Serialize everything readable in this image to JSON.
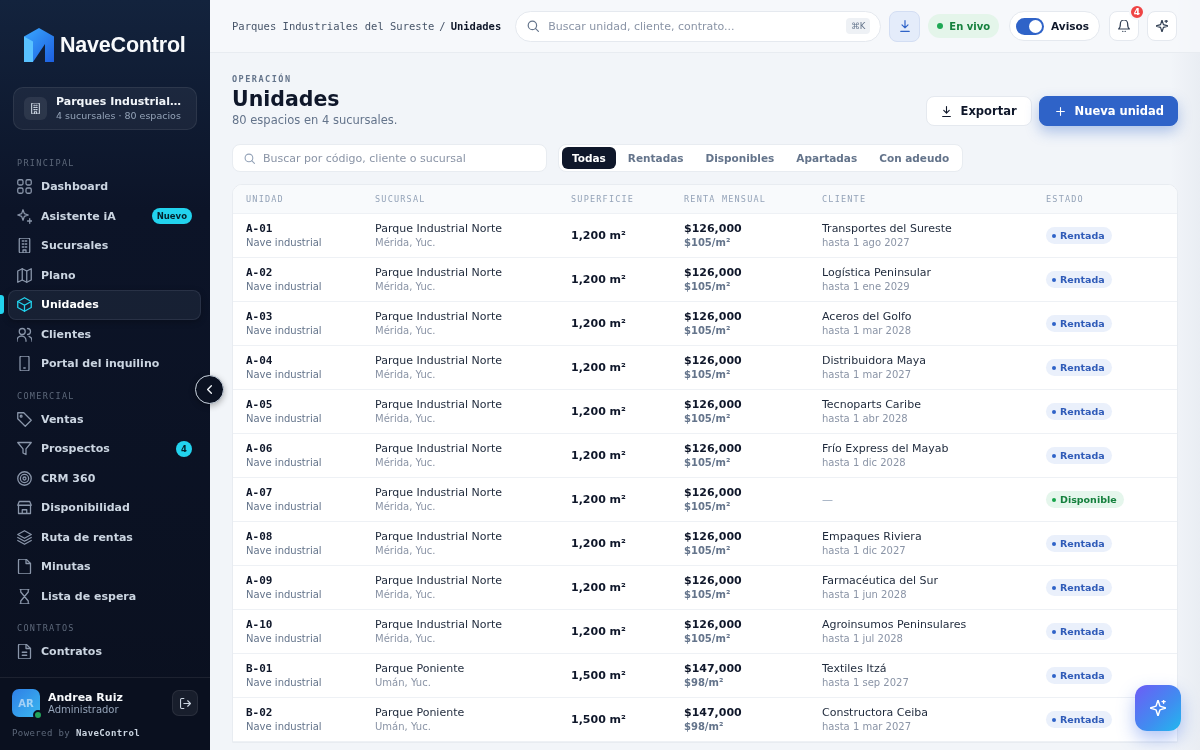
{
  "sidebar": {
    "brand": "NaveControl",
    "organization": {
      "name": "Parques Industrial…",
      "summary": "4 sucursales · 80 espacios"
    },
    "sections": [
      {
        "title": "PRINCIPAL",
        "items": [
          {
            "label": "Dashboard",
            "selected": false
          },
          {
            "label": "Asistente iA",
            "selected": false,
            "badge": "Nuevo"
          },
          {
            "label": "Sucursales",
            "selected": false
          },
          {
            "label": "Plano",
            "selected": false
          },
          {
            "label": "Unidades",
            "selected": true
          },
          {
            "label": "Clientes",
            "selected": false
          },
          {
            "label": "Portal del inquilino",
            "selected": false
          }
        ]
      },
      {
        "title": "COMERCIAL",
        "items": [
          {
            "label": "Ventas",
            "selected": false
          },
          {
            "label": "Prospectos",
            "selected": false,
            "badge": "4"
          },
          {
            "label": "CRM 360",
            "selected": false
          },
          {
            "label": "Disponibilidad",
            "selected": false
          },
          {
            "label": "Ruta de rentas",
            "selected": false
          },
          {
            "label": "Minutas",
            "selected": false
          },
          {
            "label": "Lista de espera",
            "selected": false
          }
        ]
      },
      {
        "title": "CONTRATOS",
        "items": [
          {
            "label": "Contratos",
            "selected": false
          }
        ]
      }
    ],
    "user": {
      "initials": "AR",
      "name": "Andrea Ruiz",
      "role": "Administrador",
      "online": true
    },
    "powered_by": "Powered by **NaveControl**"
  },
  "topbar": {
    "breadcrumb": [
      {
        "label": "Parques Industriales del Sureste",
        "current": false
      },
      {
        "label": "Unidades",
        "current": true
      }
    ],
    "breadcrumb_separator": "/",
    "search": {
      "placeholder": "Buscar unidad, cliente, contrato...",
      "shortcut": "⌘K"
    },
    "live": {
      "label": "En vivo"
    },
    "alerts": {
      "label": "Avisos",
      "on": true
    },
    "notifications": {
      "count": "4"
    }
  },
  "page": {
    "eyebrow": "OPERACIÓN",
    "title": "Unidades",
    "subtitle": "80 espacios en 4 sucursales.",
    "actions": [
      {
        "label": "Exportar",
        "kind": "secondary"
      },
      {
        "label": "Nueva unidad",
        "kind": "primary"
      }
    ],
    "filter_search": {
      "placeholder": "Buscar por código, cliente o sucursal"
    },
    "filter_tabs": [
      {
        "label": "Todas",
        "selected": true
      },
      {
        "label": "Rentadas",
        "selected": false
      },
      {
        "label": "Disponibles",
        "selected": false
      },
      {
        "label": "Apartadas",
        "selected": false
      },
      {
        "label": "Con adeudo",
        "selected": false
      }
    ]
  },
  "table": {
    "columns": [
      "UNIDAD",
      "SUCURSAL",
      "SUPERFICIE",
      "RENTA MENSUAL",
      "CLIENTE",
      "ESTADO"
    ],
    "rows": [
      {
        "unit": "A-01",
        "type": "Nave industrial",
        "branch": "Parque Industrial Norte",
        "location": "Mérida, Yuc.",
        "area": "1,200 m²",
        "rent": "$126,000",
        "rent_per_area": "$105/m²",
        "client": "Transportes del Sureste",
        "until": "hasta 1 ago 2027",
        "status": {
          "label": "Rentada",
          "kind": "rented"
        }
      },
      {
        "unit": "A-02",
        "type": "Nave industrial",
        "branch": "Parque Industrial Norte",
        "location": "Mérida, Yuc.",
        "area": "1,200 m²",
        "rent": "$126,000",
        "rent_per_area": "$105/m²",
        "client": "Logística Peninsular",
        "until": "hasta 1 ene 2029",
        "status": {
          "label": "Rentada",
          "kind": "rented"
        }
      },
      {
        "unit": "A-03",
        "type": "Nave industrial",
        "branch": "Parque Industrial Norte",
        "location": "Mérida, Yuc.",
        "area": "1,200 m²",
        "rent": "$126,000",
        "rent_per_area": "$105/m²",
        "client": "Aceros del Golfo",
        "until": "hasta 1 mar 2028",
        "status": {
          "label": "Rentada",
          "kind": "rented"
        }
      },
      {
        "unit": "A-04",
        "type": "Nave industrial",
        "branch": "Parque Industrial Norte",
        "location": "Mérida, Yuc.",
        "area": "1,200 m²",
        "rent": "$126,000",
        "rent_per_area": "$105/m²",
        "client": "Distribuidora Maya",
        "until": "hasta 1 mar 2027",
        "status": {
          "label": "Rentada",
          "kind": "rented"
        }
      },
      {
        "unit": "A-05",
        "type": "Nave industrial",
        "branch": "Parque Industrial Norte",
        "location": "Mérida, Yuc.",
        "area": "1,200 m²",
        "rent": "$126,000",
        "rent_per_area": "$105/m²",
        "client": "Tecnoparts Caribe",
        "until": "hasta 1 abr 2028",
        "status": {
          "label": "Rentada",
          "kind": "rented"
        }
      },
      {
        "unit": "A-06",
        "type": "Nave industrial",
        "branch": "Parque Industrial Norte",
        "location": "Mérida, Yuc.",
        "area": "1,200 m²",
        "rent": "$126,000",
        "rent_per_area": "$105/m²",
        "client": "Frío Express del Mayab",
        "until": "hasta 1 dic 2028",
        "status": {
          "label": "Rentada",
          "kind": "rented"
        }
      },
      {
        "unit": "A-07",
        "type": "Nave industrial",
        "branch": "Parque Industrial Norte",
        "location": "Mérida, Yuc.",
        "area": "1,200 m²",
        "rent": "$126,000",
        "rent_per_area": "$105/m²",
        "client": "—",
        "status": {
          "label": "Disponible",
          "kind": "available"
        }
      },
      {
        "unit": "A-08",
        "type": "Nave industrial",
        "branch": "Parque Industrial Norte",
        "location": "Mérida, Yuc.",
        "area": "1,200 m²",
        "rent": "$126,000",
        "rent_per_area": "$105/m²",
        "client": "Empaques Riviera",
        "until": "hasta 1 dic 2027",
        "status": {
          "label": "Rentada",
          "kind": "rented"
        }
      },
      {
        "unit": "A-09",
        "type": "Nave industrial",
        "branch": "Parque Industrial Norte",
        "location": "Mérida, Yuc.",
        "area": "1,200 m²",
        "rent": "$126,000",
        "rent_per_area": "$105/m²",
        "client": "Farmacéutica del Sur",
        "until": "hasta 1 jun 2028",
        "status": {
          "label": "Rentada",
          "kind": "rented"
        }
      },
      {
        "unit": "A-10",
        "type": "Nave industrial",
        "branch": "Parque Industrial Norte",
        "location": "Mérida, Yuc.",
        "area": "1,200 m²",
        "rent": "$126,000",
        "rent_per_area": "$105/m²",
        "client": "Agroinsumos Peninsulares",
        "until": "hasta 1 jul 2028",
        "status": {
          "label": "Rentada",
          "kind": "rented"
        }
      },
      {
        "unit": "B-01",
        "type": "Nave industrial",
        "branch": "Parque Poniente",
        "location": "Umán, Yuc.",
        "area": "1,500 m²",
        "rent": "$147,000",
        "rent_per_area": "$98/m²",
        "client": "Textiles Itzá",
        "until": "hasta 1 sep 2027",
        "status": {
          "label": "Rentada",
          "kind": "rented"
        }
      },
      {
        "unit": "B-02",
        "type": "Nave industrial",
        "branch": "Parque Poniente",
        "location": "Umán, Yuc.",
        "area": "1,500 m²",
        "rent": "$147,000",
        "rent_per_area": "$98/m²",
        "client": "Constructora Ceiba",
        "until": "hasta 1 mar 2027",
        "status": {
          "label": "Rentada",
          "kind": "rented"
        }
      }
    ]
  }
}
